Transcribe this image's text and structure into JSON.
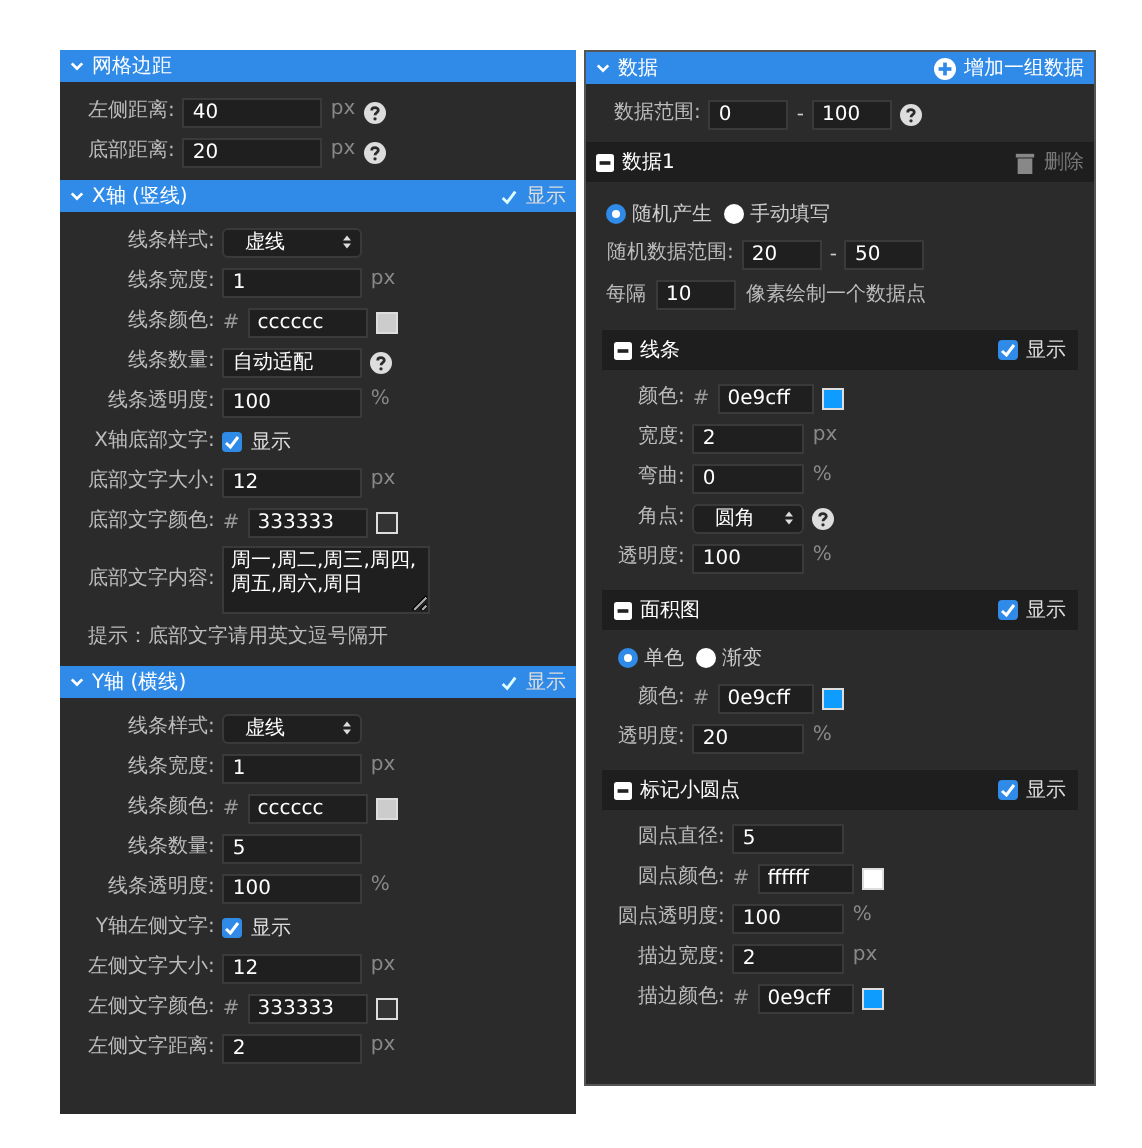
{
  "panels": [
    {
      "sections": [
        {
          "kind": "main",
          "title": "网格边距",
          "rows": [
            {
              "kind": "input",
              "label": "左侧距离:",
              "value": "40",
              "unit": "px",
              "help": true
            },
            {
              "kind": "input",
              "label": "底部距离:",
              "value": "20",
              "unit": "px",
              "help": true
            }
          ]
        },
        {
          "kind": "main",
          "title": "X轴 (竖线)",
          "toggle": {
            "label": "显示",
            "checked": true
          },
          "rows": [
            {
              "kind": "select",
              "label": "线条样式:",
              "value": "虚线"
            },
            {
              "kind": "input",
              "label": "线条宽度:",
              "value": "1",
              "unit": "px"
            },
            {
              "kind": "color",
              "label": "线条颜色:",
              "prefix": "#",
              "value": "cccccc",
              "color": "#cccccc"
            },
            {
              "kind": "input",
              "label": "线条数量:",
              "value": "自动适配",
              "help": true
            },
            {
              "kind": "input",
              "label": "线条透明度:",
              "value": "100",
              "unit": "%"
            },
            {
              "kind": "check",
              "label": "X轴底部文字:",
              "text": "显示",
              "checked": true
            },
            {
              "kind": "input",
              "label": "底部文字大小:",
              "value": "12",
              "unit": "px"
            },
            {
              "kind": "color",
              "label": "底部文字颜色:",
              "prefix": "#",
              "value": "333333",
              "color": "#333333"
            },
            {
              "kind": "textarea",
              "label": "底部文字内容:",
              "value": "周一,周二,周三,周四,周五,周六,周日"
            },
            {
              "kind": "note",
              "text": "提示：底部文字请用英文逗号隔开"
            }
          ]
        },
        {
          "kind": "main",
          "title": "Y轴 (横线)",
          "toggle": {
            "label": "显示",
            "checked": true
          },
          "rows": [
            {
              "kind": "select",
              "label": "线条样式:",
              "value": "虚线"
            },
            {
              "kind": "input",
              "label": "线条宽度:",
              "value": "1",
              "unit": "px"
            },
            {
              "kind": "color",
              "label": "线条颜色:",
              "prefix": "#",
              "value": "cccccc",
              "color": "#cccccc"
            },
            {
              "kind": "input",
              "label": "线条数量:",
              "value": "5"
            },
            {
              "kind": "input",
              "label": "线条透明度:",
              "value": "100",
              "unit": "%"
            },
            {
              "kind": "check",
              "label": "Y轴左侧文字:",
              "text": "显示",
              "checked": true
            },
            {
              "kind": "input",
              "label": "左侧文字大小:",
              "value": "12",
              "unit": "px"
            },
            {
              "kind": "color",
              "label": "左侧文字颜色:",
              "prefix": "#",
              "value": "333333",
              "color": "#333333"
            },
            {
              "kind": "input",
              "label": "左侧文字距离:",
              "value": "2",
              "unit": "px"
            }
          ]
        }
      ]
    },
    {
      "sections": [
        {
          "kind": "main",
          "title": "数据",
          "action": {
            "kind": "add",
            "label": "增加一组数据",
            "disabled": false
          },
          "rows": [
            {
              "kind": "range",
              "label": "数据范围:",
              "from": "0",
              "sep": "-",
              "to": "100",
              "help": true
            }
          ]
        },
        {
          "kind": "group",
          "title": "数据1",
          "action": {
            "kind": "trash",
            "label": "删除",
            "disabled": true
          },
          "rows": [
            {
              "kind": "radio",
              "options": [
                {
                  "label": "随机产生",
                  "selected": true
                },
                {
                  "label": "手动填写",
                  "selected": false
                }
              ]
            },
            {
              "kind": "range",
              "label": "随机数据范围:",
              "from": "20",
              "sep": "-",
              "to": "50"
            },
            {
              "kind": "every",
              "label": "每隔",
              "value": "10",
              "text": "像素绘制一个数据点"
            }
          ]
        },
        {
          "kind": "sub",
          "title": "线条",
          "toggle": {
            "label": "显示",
            "checked": true
          },
          "rows": [
            {
              "kind": "color",
              "label": "颜色:",
              "prefix": "#",
              "value": "0e9cff",
              "color": "#0e9cff"
            },
            {
              "kind": "input",
              "label": "宽度:",
              "value": "2",
              "unit": "px"
            },
            {
              "kind": "input",
              "label": "弯曲:",
              "value": "0",
              "unit": "%"
            },
            {
              "kind": "select",
              "label": "角点:",
              "value": "圆角",
              "help": true
            },
            {
              "kind": "input",
              "label": "透明度:",
              "value": "100",
              "unit": "%"
            }
          ]
        },
        {
          "kind": "sub",
          "title": "面积图",
          "toggle": {
            "label": "显示",
            "checked": true
          },
          "rows": [
            {
              "kind": "radio",
              "options": [
                {
                  "label": "单色",
                  "selected": true
                },
                {
                  "label": "渐变",
                  "selected": false
                }
              ]
            },
            {
              "kind": "color",
              "label": "颜色:",
              "prefix": "#",
              "value": "0e9cff",
              "color": "#0e9cff"
            },
            {
              "kind": "input",
              "label": "透明度:",
              "value": "20",
              "unit": "%"
            }
          ]
        },
        {
          "kind": "sub",
          "title": "标记小圆点",
          "toggle": {
            "label": "显示",
            "checked": true
          },
          "rows": [
            {
              "kind": "input",
              "label": "圆点直径:",
              "value": "5"
            },
            {
              "kind": "color",
              "label": "圆点颜色:",
              "prefix": "#",
              "value": "ffffff",
              "color": "#ffffff"
            },
            {
              "kind": "input",
              "label": "圆点透明度:",
              "value": "100",
              "unit": "%"
            },
            {
              "kind": "input",
              "label": "描边宽度:",
              "value": "2",
              "unit": "px"
            },
            {
              "kind": "color",
              "label": "描边颜色:",
              "prefix": "#",
              "value": "0e9cff",
              "color": "#0e9cff"
            }
          ]
        }
      ]
    }
  ]
}
